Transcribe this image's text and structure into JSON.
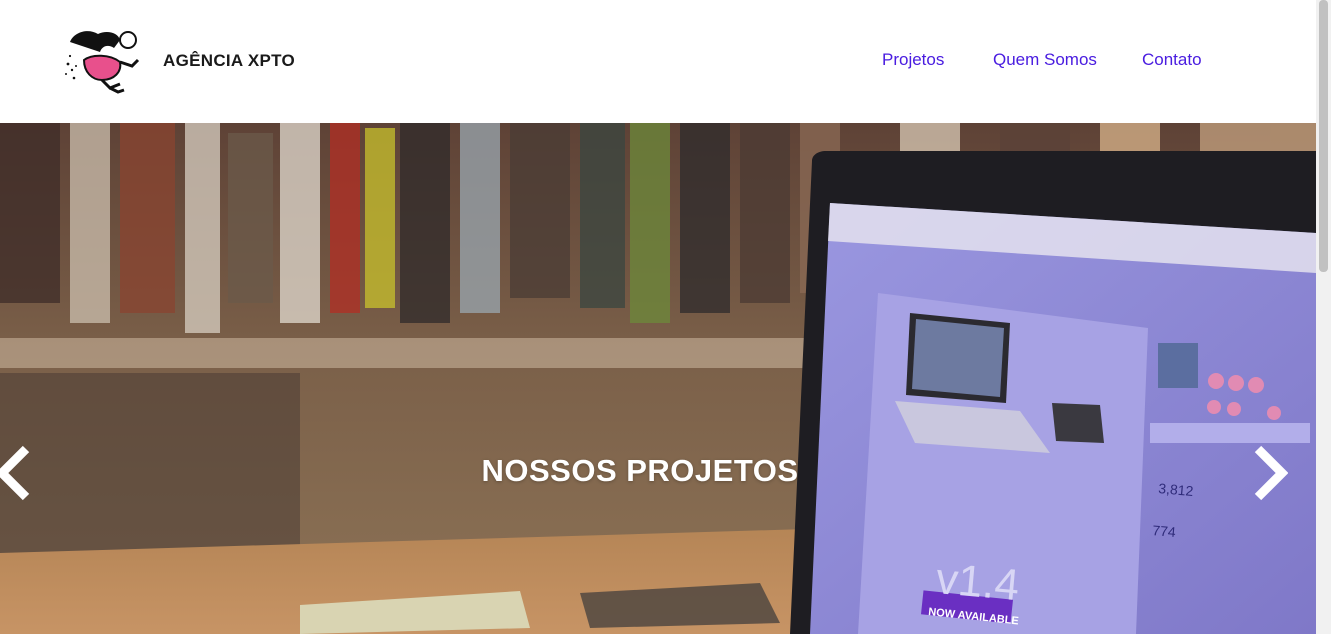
{
  "header": {
    "brand": "AGÊNCIA XPTO",
    "nav": [
      {
        "label": "Projetos"
      },
      {
        "label": "Quem Somos"
      },
      {
        "label": "Contato"
      }
    ]
  },
  "hero": {
    "title": "NOSSOS PROJETOS",
    "prev_icon": "chevron-left-icon",
    "next_icon": "chevron-right-icon",
    "screen_text": {
      "price_count": "3,812",
      "comments_count": "774",
      "version": "v1.4",
      "badge": "NOW AVAILABLE"
    }
  },
  "colors": {
    "nav_link": "#4a1de0",
    "brand_text": "#1a1a1a",
    "hero_title": "#ffffff",
    "screen_tint": "#8b86d6"
  }
}
